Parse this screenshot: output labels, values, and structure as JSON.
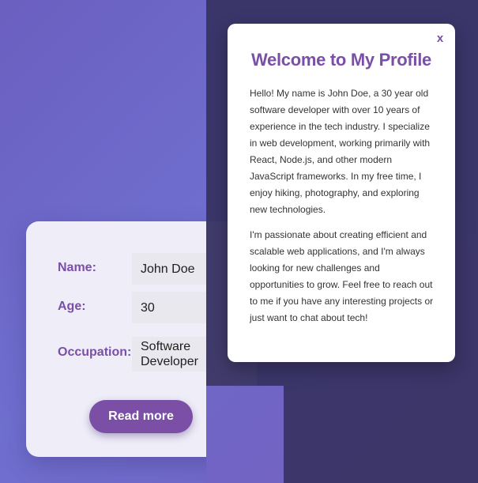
{
  "profile_card": {
    "fields": [
      {
        "label": "Name:",
        "value": "John Doe"
      },
      {
        "label": "Age:",
        "value": "30"
      },
      {
        "label": "Occupation:",
        "value": "Software Developer"
      }
    ],
    "read_more_label": "Read more"
  },
  "modal": {
    "close_label": "x",
    "title": "Welcome to My Profile",
    "paragraphs": [
      "Hello! My name is John Doe, a 30 year old software developer with over 10 years of experience in the tech industry. I specialize in web development, working primarily with React, Node.js, and other modern JavaScript frameworks. In my free time, I enjoy hiking, photography, and exploring new technologies.",
      "I'm passionate about creating efficient and scalable web applications, and I'm always looking for new challenges and opportunities to grow. Feel free to reach out to me if you have any interesting projects or just want to chat about tech!"
    ]
  },
  "colors": {
    "accent": "#7a4fa6",
    "overlay": "#3a3566",
    "background": "#6b5fc0",
    "card": "#efedf8"
  },
  "icons": {
    "close": "close-icon"
  }
}
